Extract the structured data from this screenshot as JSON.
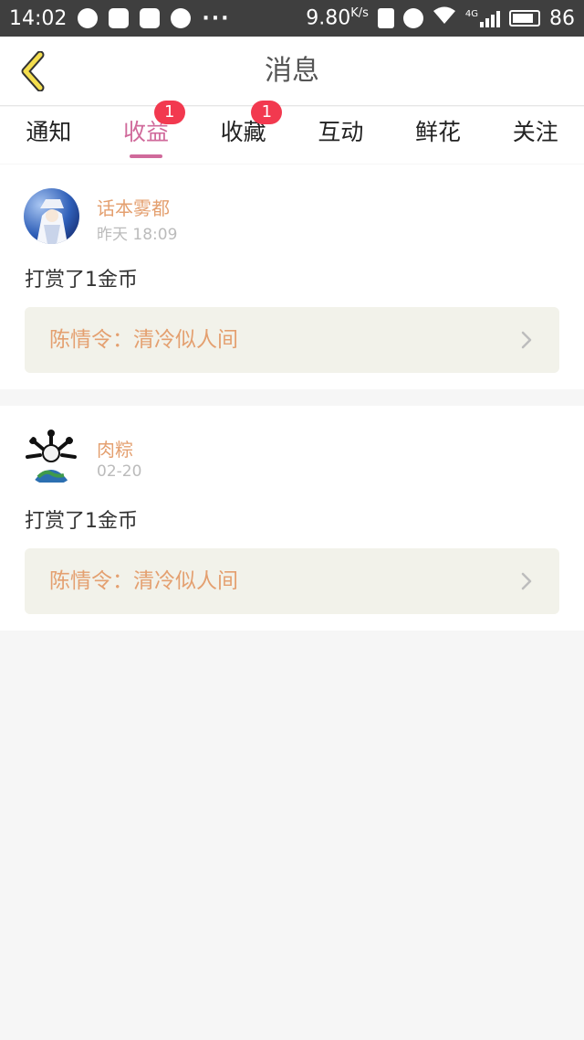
{
  "status_bar": {
    "time": "14:02",
    "speed": "9.80",
    "speed_unit": "K/s",
    "network": "4G",
    "battery": "86"
  },
  "header": {
    "title": "消息"
  },
  "tabs": [
    {
      "label": "通知",
      "active": false
    },
    {
      "label": "收益",
      "active": true,
      "badge": "1"
    },
    {
      "label": "收藏",
      "active": false,
      "badge": "1"
    },
    {
      "label": "互动",
      "active": false
    },
    {
      "label": "鲜花",
      "active": false
    },
    {
      "label": "关注",
      "active": false
    }
  ],
  "messages": [
    {
      "user": "话本雾都",
      "time": "昨天 18:09",
      "text": "打赏了1金币",
      "book": "陈情令：清冷似人间"
    },
    {
      "user": "肉粽",
      "time": "02-20",
      "text": "打赏了1金币",
      "book": "陈情令：清冷似人间"
    }
  ],
  "colors": {
    "accent": "#d06a9b",
    "badge": "#f2394f",
    "name": "#e4a070",
    "back_icon": "#f4de4e"
  }
}
